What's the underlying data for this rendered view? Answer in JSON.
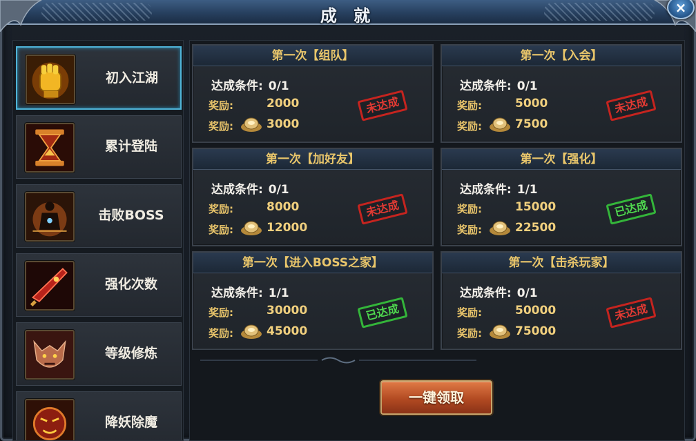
{
  "window": {
    "title": "成 就",
    "close_glyph": "×"
  },
  "sidebar": {
    "items": [
      {
        "label": "初入江湖",
        "icon": "golden-fist-icon",
        "active": true
      },
      {
        "label": "累计登陆",
        "icon": "hourglass-icon",
        "active": false
      },
      {
        "label": "击败BOSS",
        "icon": "meditating-figure-icon",
        "active": false
      },
      {
        "label": "强化次数",
        "icon": "blade-icon",
        "active": false
      },
      {
        "label": "等级修炼",
        "icon": "demon-face-icon",
        "active": false
      },
      {
        "label": "降妖除魔",
        "icon": "demon-mask-icon",
        "active": false
      }
    ]
  },
  "common": {
    "cond_label": "达成条件:",
    "reward_label": "奖励:",
    "stamp_not_done": "未达成",
    "stamp_done": "已达成"
  },
  "achievements": [
    {
      "title": "第一次【组队】",
      "progress": "0/1",
      "reward_1": "2000",
      "reward_2": "3000",
      "done": false
    },
    {
      "title": "第一次【入会】",
      "progress": "0/1",
      "reward_1": "5000",
      "reward_2": "7500",
      "done": false
    },
    {
      "title": "第一次【加好友】",
      "progress": "0/1",
      "reward_1": "8000",
      "reward_2": "12000",
      "done": false
    },
    {
      "title": "第一次【强化】",
      "progress": "1/1",
      "reward_1": "15000",
      "reward_2": "22500",
      "done": true
    },
    {
      "title": "第一次【进入BOSS之家】",
      "progress": "1/1",
      "reward_1": "30000",
      "reward_2": "45000",
      "done": true
    },
    {
      "title": "第一次【击杀玩家】",
      "progress": "0/1",
      "reward_1": "50000",
      "reward_2": "75000",
      "done": false
    }
  ],
  "actions": {
    "claim_all_label": "一键领取"
  },
  "colors": {
    "accent_gold": "#e9c66b",
    "stamp_red": "#e23a33",
    "stamp_green": "#4fd94f",
    "active_border": "#4fb4d8"
  }
}
